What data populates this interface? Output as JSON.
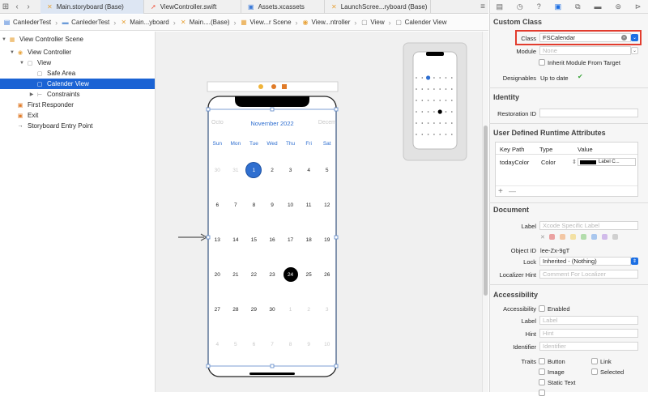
{
  "tabs": [
    {
      "label": "Main.storyboard (Base)",
      "icon": "storyboard-icon",
      "active": true
    },
    {
      "label": "ViewController.swift",
      "icon": "swift-icon",
      "active": false
    },
    {
      "label": "Assets.xcassets",
      "icon": "assets-icon",
      "active": false
    },
    {
      "label": "LaunchScree...ryboard (Base)",
      "icon": "storyboard-icon",
      "active": false
    }
  ],
  "jumpbar": [
    "CanlederTest",
    "CanlederTest",
    "Main...yboard",
    "Main....(Base)",
    "View...r Scene",
    "View...ntroller",
    "View",
    "Calender View"
  ],
  "outline": {
    "scene": "View Controller Scene",
    "vc": "View Controller",
    "view": "View",
    "safe_area": "Safe Area",
    "calender_view": "Calender View",
    "constraints": "Constraints",
    "first_responder": "First Responder",
    "exit": "Exit",
    "entry_point": "Storyboard Entry Point"
  },
  "calendar": {
    "prev_month": "Octo",
    "month": "November 2022",
    "next_month": "Decem",
    "weekdays": [
      "Sun",
      "Mon",
      "Tue",
      "Wed",
      "Thu",
      "Fri",
      "Sat"
    ],
    "weeks": [
      [
        "30",
        "31",
        "1",
        "2",
        "3",
        "4",
        "5"
      ],
      [
        "6",
        "7",
        "8",
        "9",
        "10",
        "11",
        "12"
      ],
      [
        "13",
        "14",
        "15",
        "16",
        "17",
        "18",
        "19"
      ],
      [
        "20",
        "21",
        "22",
        "23",
        "24",
        "25",
        "26"
      ],
      [
        "27",
        "28",
        "29",
        "30",
        "1",
        "2",
        "3"
      ],
      [
        "4",
        "5",
        "6",
        "7",
        "8",
        "9",
        "10"
      ]
    ],
    "selected_day": "1",
    "today_day": "24",
    "accent": "#2f6fd0",
    "today_color": "#000000"
  },
  "inspector": {
    "custom_class_title": "Custom Class",
    "class_label": "Class",
    "class_value": "FSCalendar",
    "module_label": "Module",
    "module_placeholder": "None",
    "inherit_label": "Inherit Module From Target",
    "designables_label": "Designables",
    "designables_value": "Up to date",
    "identity_title": "Identity",
    "restoration_label": "Restoration ID",
    "udra_title": "User Defined Runtime Attributes",
    "udra_headers": [
      "Key Path",
      "Type",
      "Value"
    ],
    "udra_row": {
      "key": "todayColor",
      "type": "Color",
      "value": "Label C..."
    },
    "document_title": "Document",
    "doc_label_label": "Label",
    "doc_label_placeholder": "Xcode Specific Label",
    "object_id_label": "Object ID",
    "object_id_value": "lee-Zx-9gT",
    "lock_label": "Lock",
    "lock_value": "Inherited - (Nothing)",
    "loc_hint_label": "Localizer Hint",
    "loc_hint_placeholder": "Comment For Localizer",
    "accessibility_title": "Accessibility",
    "acc_label": "Accessibility",
    "enabled_label": "Enabled",
    "label_label": "Label",
    "label_placeholder": "Label",
    "hint_label": "Hint",
    "hint_placeholder": "Hint",
    "identifier_label": "Identifier",
    "identifier_placeholder": "Identifier",
    "traits_label": "Traits",
    "traits": [
      "Button",
      "Link",
      "Image",
      "Selected",
      "Static Text"
    ],
    "label_colors": [
      "#e05b5b",
      "#f0a060",
      "#f0d060",
      "#7cc870",
      "#6aa0e8",
      "#b38be0",
      "#b0b0b0"
    ]
  },
  "udra_add": "+",
  "udra_remove": "—"
}
